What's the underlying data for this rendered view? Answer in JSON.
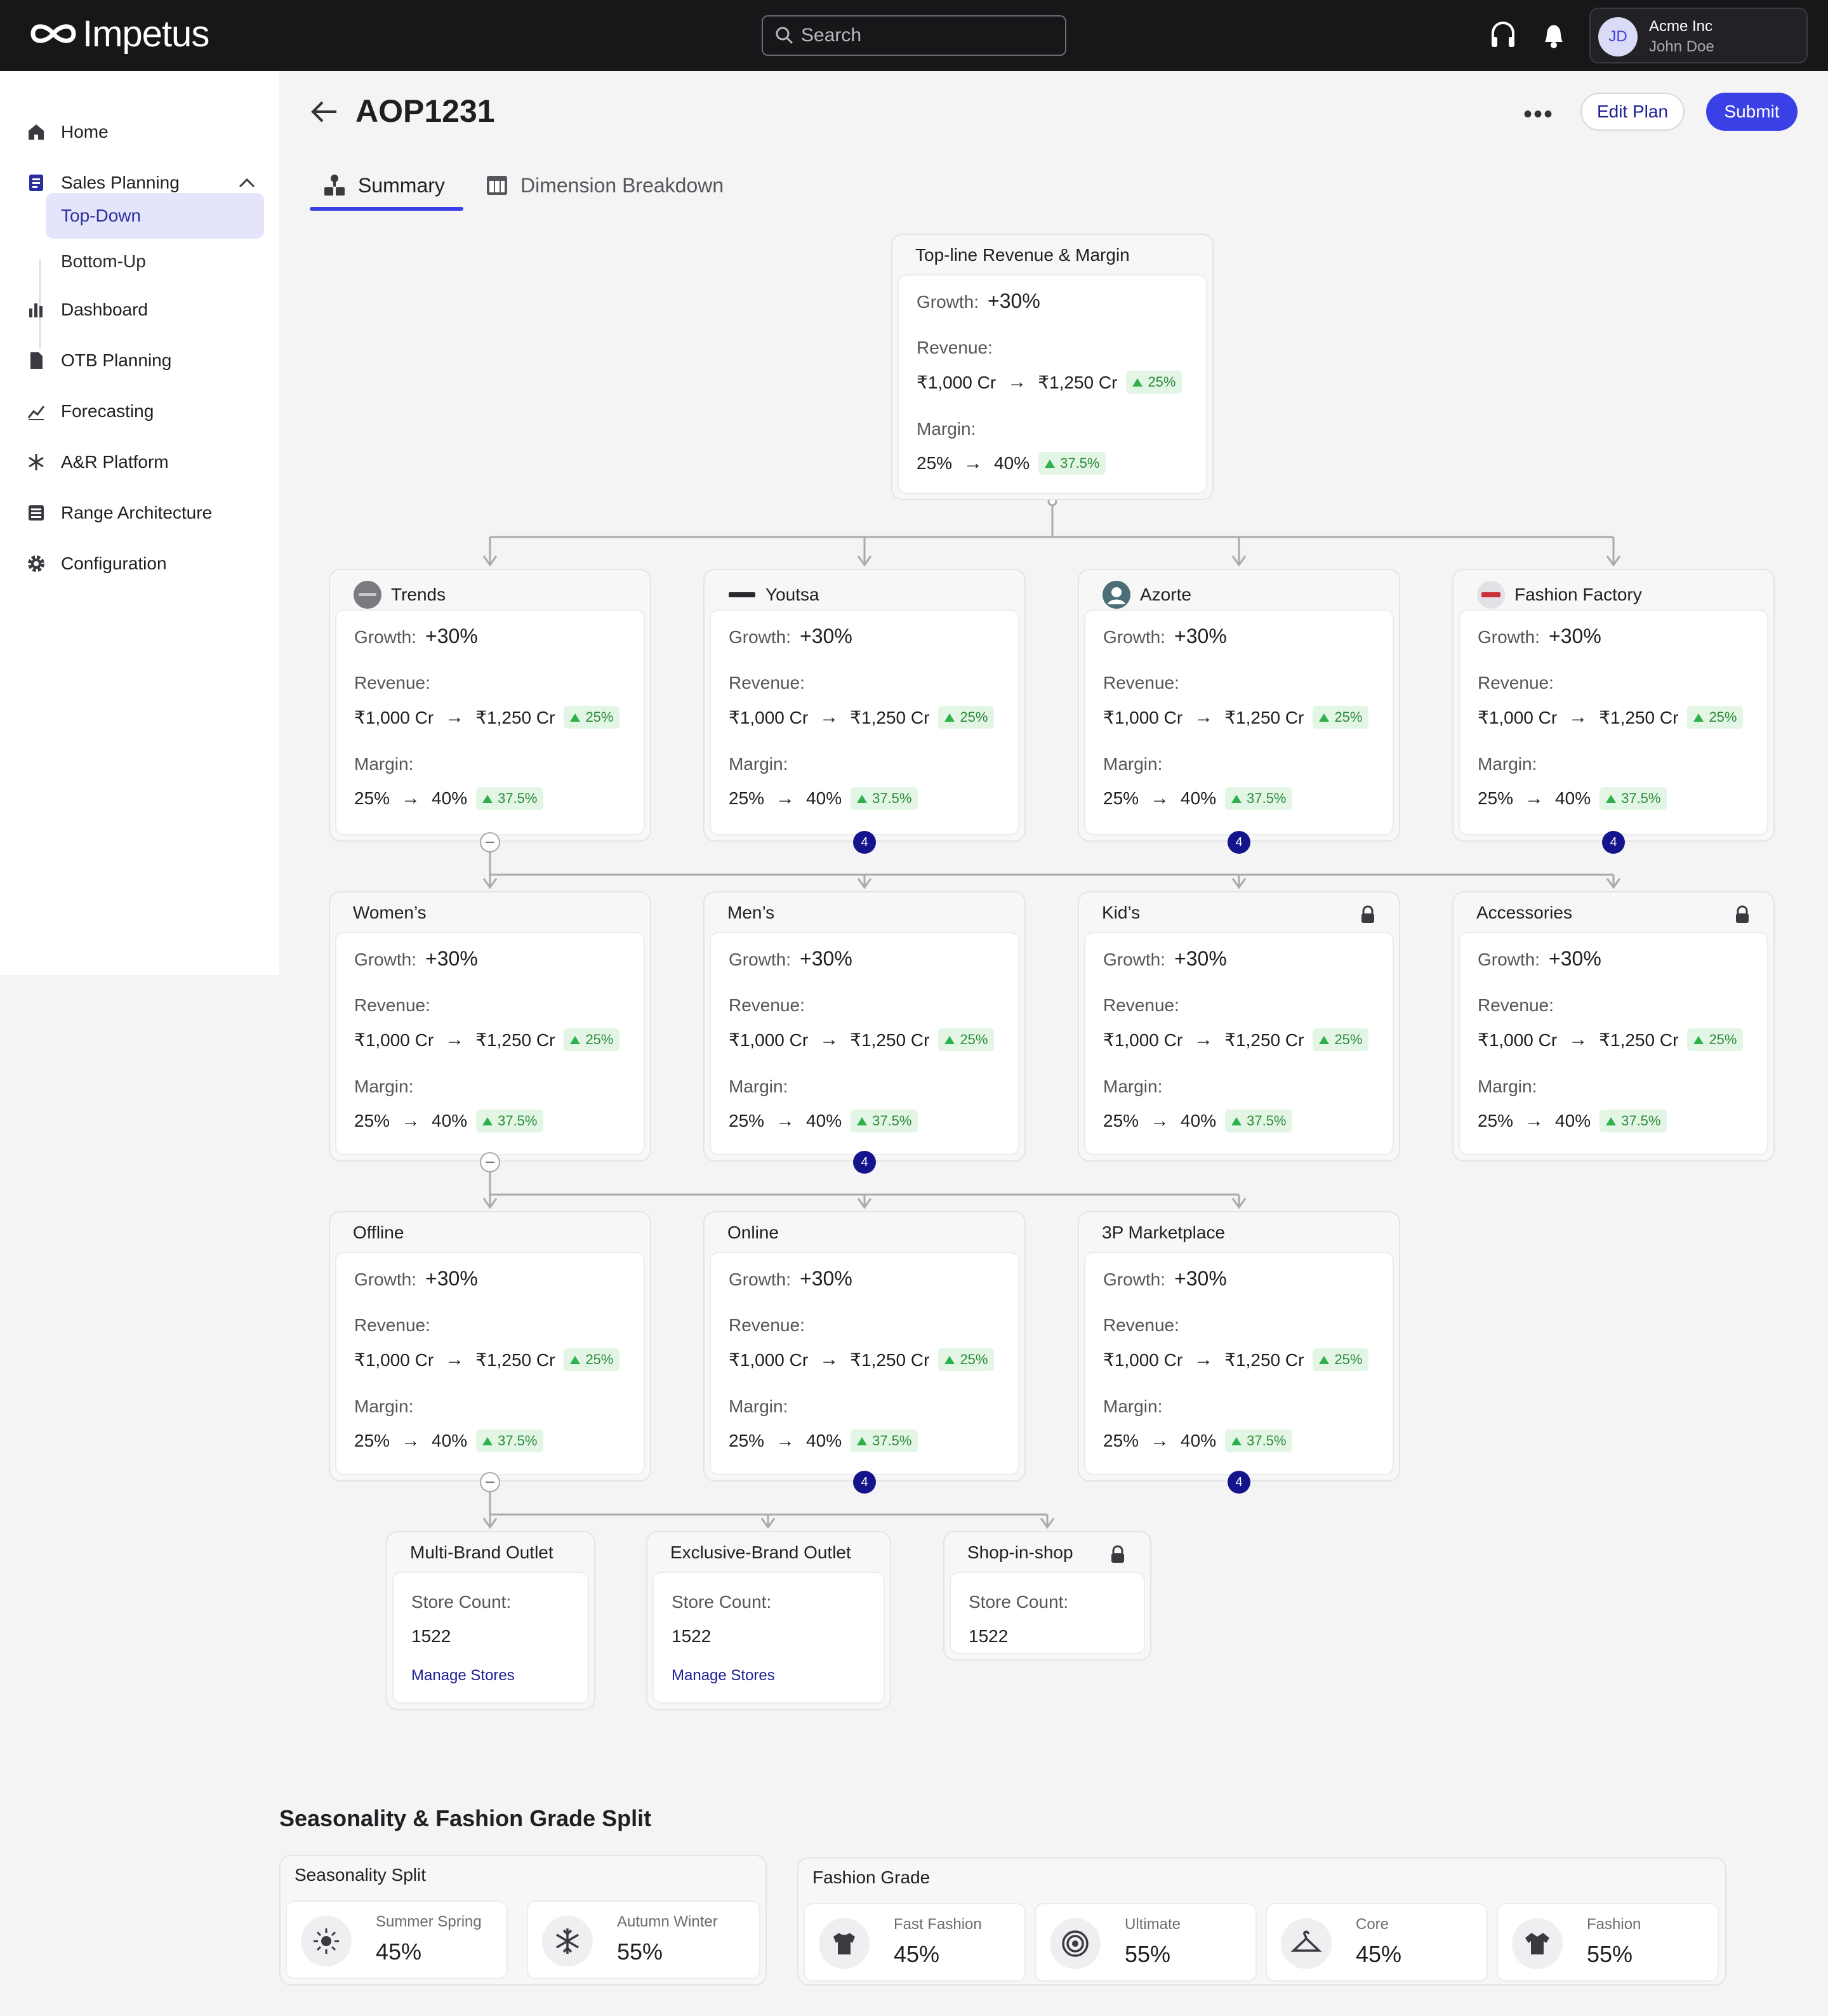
{
  "app": {
    "name": "Impetus"
  },
  "search": {
    "placeholder": "Search"
  },
  "account": {
    "initials": "JD",
    "company": "Acme Inc",
    "user": "John Doe"
  },
  "sidebar": {
    "items": [
      {
        "label": "Home",
        "icon": "home-icon"
      },
      {
        "label": "Sales Planning",
        "icon": "book-icon"
      },
      {
        "label": "Dashboard",
        "icon": "bar-chart-icon"
      },
      {
        "label": "OTB Planning",
        "icon": "document-icon"
      },
      {
        "label": "Forecasting",
        "icon": "line-chart-icon"
      },
      {
        "label": "A&R Platform",
        "icon": "asterisk-icon"
      },
      {
        "label": "Range Architecture",
        "icon": "list-icon"
      },
      {
        "label": "Configuration",
        "icon": "gear-icon"
      }
    ],
    "sub_items": [
      {
        "label": "Top-Down",
        "active": true
      },
      {
        "label": "Bottom-Up",
        "active": false
      }
    ]
  },
  "header": {
    "title": "AOP1231",
    "edit_label": "Edit Plan",
    "submit_label": "Submit",
    "more": "•••"
  },
  "tabs": [
    {
      "label": "Summary",
      "active": true,
      "icon": "hierarchy-icon"
    },
    {
      "label": "Dimension Breakdown",
      "active": false,
      "icon": "table-icon"
    }
  ],
  "labels": {
    "growth": "Growth:",
    "revenue": "Revenue:",
    "margin": "Margin:",
    "store_count": "Store Count:",
    "manage": "Manage Stores",
    "arrow": "→"
  },
  "tree": {
    "root": {
      "title": "Top-line Revenue & Margin",
      "growth": "+30%",
      "rev_from": "₹1,000 Cr",
      "rev_to": "₹1,250 Cr",
      "rev_change": "25%",
      "margin_from": "25%",
      "margin_to": "40%",
      "margin_change": "37.5%"
    },
    "brands": [
      {
        "title": "Trends",
        "logo": "TRENDS",
        "growth": "+30%",
        "rev_from": "₹1,000 Cr",
        "rev_to": "₹1,250 Cr",
        "rev_change": "25%",
        "margin_from": "25%",
        "margin_to": "40%",
        "margin_change": "37.5%"
      },
      {
        "title": "Youtsa",
        "logo": "youstа",
        "growth": "+30%",
        "rev_from": "₹1,000 Cr",
        "rev_to": "₹1,250 Cr",
        "rev_change": "25%",
        "margin_from": "25%",
        "margin_to": "40%",
        "margin_change": "37.5%",
        "children": "4"
      },
      {
        "title": "Azorte",
        "growth": "+30%",
        "rev_from": "₹1,000 Cr",
        "rev_to": "₹1,250 Cr",
        "rev_change": "25%",
        "margin_from": "25%",
        "margin_to": "40%",
        "margin_change": "37.5%",
        "children": "4"
      },
      {
        "title": "Fashion Factory",
        "growth": "+30%",
        "rev_from": "₹1,000 Cr",
        "rev_to": "₹1,250 Cr",
        "rev_change": "25%",
        "margin_from": "25%",
        "margin_to": "40%",
        "margin_change": "37.5%",
        "children": "4"
      }
    ],
    "categories": [
      {
        "title": "Women’s",
        "locked": false,
        "growth": "+30%",
        "rev_from": "₹1,000 Cr",
        "rev_to": "₹1,250 Cr",
        "rev_change": "25%",
        "margin_from": "25%",
        "margin_to": "40%",
        "margin_change": "37.5%"
      },
      {
        "title": "Men’s",
        "locked": false,
        "growth": "+30%",
        "rev_from": "₹1,000 Cr",
        "rev_to": "₹1,250 Cr",
        "rev_change": "25%",
        "margin_from": "25%",
        "margin_to": "40%",
        "margin_change": "37.5%",
        "children": "4"
      },
      {
        "title": "Kid’s",
        "locked": true,
        "growth": "+30%",
        "rev_from": "₹1,000 Cr",
        "rev_to": "₹1,250 Cr",
        "rev_change": "25%",
        "margin_from": "25%",
        "margin_to": "40%",
        "margin_change": "37.5%"
      },
      {
        "title": "Accessories",
        "locked": true,
        "growth": "+30%",
        "rev_from": "₹1,000 Cr",
        "rev_to": "₹1,250 Cr",
        "rev_change": "25%",
        "margin_from": "25%",
        "margin_to": "40%",
        "margin_change": "37.5%"
      }
    ],
    "channels": [
      {
        "title": "Offline",
        "growth": "+30%",
        "rev_from": "₹1,000 Cr",
        "rev_to": "₹1,250 Cr",
        "rev_change": "25%",
        "margin_from": "25%",
        "margin_to": "40%",
        "margin_change": "37.5%"
      },
      {
        "title": "Online",
        "growth": "+30%",
        "rev_from": "₹1,000 Cr",
        "rev_to": "₹1,250 Cr",
        "rev_change": "25%",
        "margin_from": "25%",
        "margin_to": "40%",
        "margin_change": "37.5%",
        "children": "4"
      },
      {
        "title": "3P Marketplace",
        "growth": "+30%",
        "rev_from": "₹1,000 Cr",
        "rev_to": "₹1,250 Cr",
        "rev_change": "25%",
        "margin_from": "25%",
        "margin_to": "40%",
        "margin_change": "37.5%",
        "children": "4"
      }
    ],
    "formats": [
      {
        "title": "Multi-Brand Outlet",
        "locked": false,
        "store_count": "1522",
        "manage": true
      },
      {
        "title": "Exclusive-Brand Outlet",
        "locked": false,
        "store_count": "1522",
        "manage": true
      },
      {
        "title": "Shop-in-shop",
        "locked": true,
        "store_count": "1522",
        "manage": false
      }
    ]
  },
  "split": {
    "title": "Seasonality & Fashion Grade Split",
    "seasonality": {
      "title": "Seasonality Split",
      "items": [
        {
          "label": "Summer Spring",
          "value": "45%",
          "icon": "sun-icon"
        },
        {
          "label": "Autumn Winter",
          "value": "55%",
          "icon": "snowflake-icon"
        }
      ]
    },
    "fashion_grade": {
      "title": "Fashion Grade",
      "items": [
        {
          "label": "Fast Fashion",
          "value": "45%",
          "icon": "tshirt-icon"
        },
        {
          "label": "Ultimate",
          "value": "55%",
          "icon": "target-icon"
        },
        {
          "label": "Core",
          "value": "45%",
          "icon": "hanger-icon"
        },
        {
          "label": "Fashion",
          "value": "55%",
          "icon": "shirt-icon"
        }
      ]
    }
  }
}
